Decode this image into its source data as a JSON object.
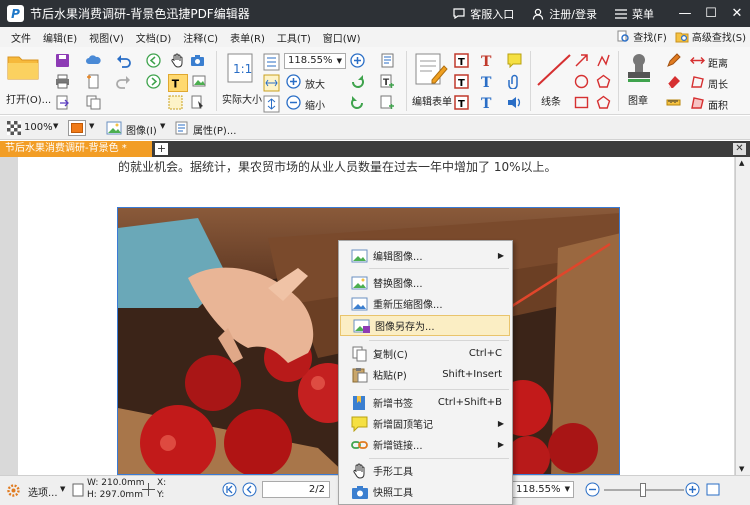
{
  "app": {
    "title": "节后水果消费调研-背景色迅捷PDF编辑器",
    "logo": "P",
    "service": "客服入口",
    "login": "注册/登录",
    "menu": "菜单"
  },
  "menubar": {
    "items": [
      "文件",
      "编辑(E)",
      "视图(V)",
      "文档(D)",
      "注释(C)",
      "表单(R)",
      "工具(T)",
      "窗口(W)"
    ],
    "find": "查找(F)",
    "advanced_find": "高级查找(S)"
  },
  "ribbon": {
    "open": "打开(O)...",
    "actual_size": "实际大小",
    "zoom_value": "118.55%",
    "zoom_in": "放大",
    "zoom_out": "缩小",
    "edit_form": "编辑表单",
    "line": "线条",
    "stamp": "图章",
    "distance": "距离",
    "perimeter": "周长",
    "area": "面积"
  },
  "fmtbar": {
    "zoom": "100%",
    "image_menu": "图像(I)",
    "properties": "属性(P)..."
  },
  "tab": {
    "title": "节后水果消费调研-背景色 *",
    "add": "+",
    "close": "✕"
  },
  "document": {
    "text": "的就业机会。据统计，果农贸市场的从业人员数量在过去一年中增加了 10%以上。"
  },
  "context_menu": {
    "items": [
      {
        "label": "编辑图像...",
        "shortcut": "",
        "submenu": true
      },
      {
        "label": "替换图像...",
        "shortcut": "",
        "submenu": false
      },
      {
        "label": "重新压缩图像...",
        "shortcut": "",
        "submenu": false
      },
      {
        "label": "图像另存为...",
        "shortcut": "",
        "submenu": false
      },
      {
        "label": "复制(C)",
        "shortcut": "Ctrl+C",
        "submenu": false
      },
      {
        "label": "粘贴(P)",
        "shortcut": "Shift+Insert",
        "submenu": false
      },
      {
        "label": "新增书签",
        "shortcut": "Ctrl+Shift+B",
        "submenu": false
      },
      {
        "label": "新增固顶笔记",
        "shortcut": "",
        "submenu": true
      },
      {
        "label": "新增链接...",
        "shortcut": "",
        "submenu": true
      },
      {
        "label": "手形工具",
        "shortcut": "",
        "submenu": false
      },
      {
        "label": "快照工具",
        "shortcut": "",
        "submenu": false
      }
    ]
  },
  "statusbar": {
    "options": "选项...",
    "width": "W: 210.0mm",
    "height": "H: 297.0mm",
    "x": "X:",
    "y": "Y:",
    "page": "2",
    "page_total": "/2",
    "zoom": "118.55%"
  },
  "colors": {
    "titlebar": "#2d3136",
    "tab_accent": "#f29d25",
    "highlight": "#fbeec4",
    "arrow": "#e0462b"
  }
}
